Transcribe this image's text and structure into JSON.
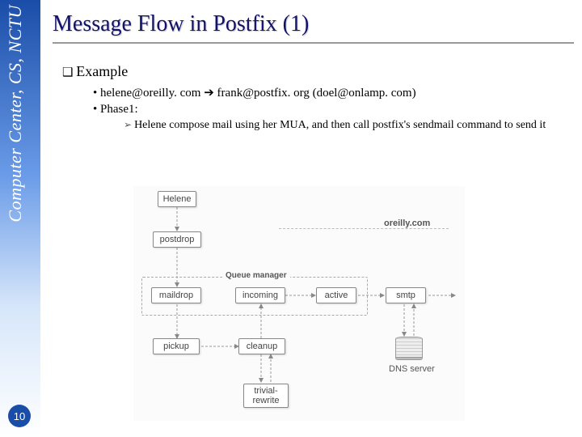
{
  "sidebar": {
    "org": "Computer Center, CS, NCTU"
  },
  "page_number": "10",
  "title": "Message Flow in Postfix (1)",
  "bullets": {
    "example": "Example",
    "line1": "helene@oreilly. com ➔ frank@postfix. org (doel@onlamp. com)",
    "line2": "Phase1:",
    "sub1": "Helene compose mail using her MUA, and then call postfix's sendmail command to send it"
  },
  "diagram": {
    "helene": "Helene",
    "postdrop": "postdrop",
    "oreilly": "oreilly.com",
    "qmanager": "Queue manager",
    "maildrop": "maildrop",
    "incoming": "incoming",
    "active": "active",
    "smtp": "smtp",
    "pickup": "pickup",
    "cleanup": "cleanup",
    "dns": "DNS server",
    "trivial": "trivial-\nrewrite"
  }
}
